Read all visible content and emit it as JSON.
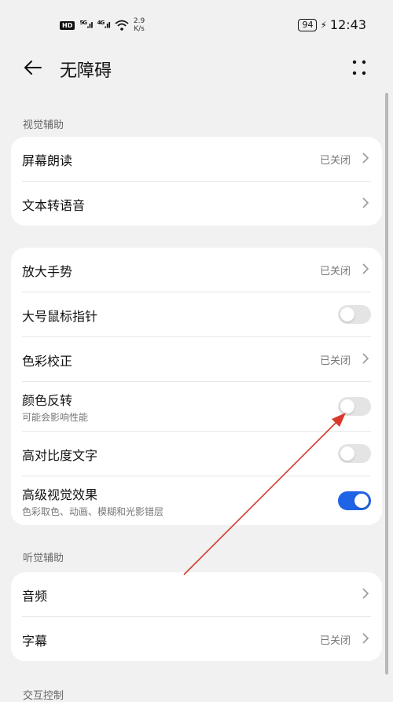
{
  "status_bar": {
    "hd": "HD",
    "sim1": "5G",
    "sim2": "4G",
    "speed_value": "2.9",
    "speed_unit": "K/s",
    "battery": "94",
    "time": "12:43"
  },
  "header": {
    "title": "无障碍"
  },
  "sections": {
    "visual": "视觉辅助",
    "hearing": "听觉辅助",
    "interaction": "交互控制"
  },
  "visual_card1": {
    "screen_reader": {
      "label": "屏幕朗读",
      "value": "已关闭"
    },
    "tts": {
      "label": "文本转语音"
    }
  },
  "visual_card2": {
    "magnify": {
      "label": "放大手势",
      "value": "已关闭"
    },
    "large_pointer": {
      "label": "大号鼠标指针",
      "toggle": false
    },
    "color_correction": {
      "label": "色彩校正",
      "value": "已关闭"
    },
    "color_inversion": {
      "label": "颜色反转",
      "sub": "可能会影响性能",
      "toggle": false
    },
    "high_contrast": {
      "label": "高对比度文字",
      "toggle": false
    },
    "advanced_visual": {
      "label": "高级视觉效果",
      "sub": "色彩取色、动画、模糊和光影错层",
      "toggle": true
    }
  },
  "hearing_card": {
    "audio": {
      "label": "音频"
    },
    "captions": {
      "label": "字幕",
      "value": "已关闭"
    }
  },
  "colors": {
    "accent": "#1f63e6",
    "annotation_arrow": "#d9372a"
  }
}
